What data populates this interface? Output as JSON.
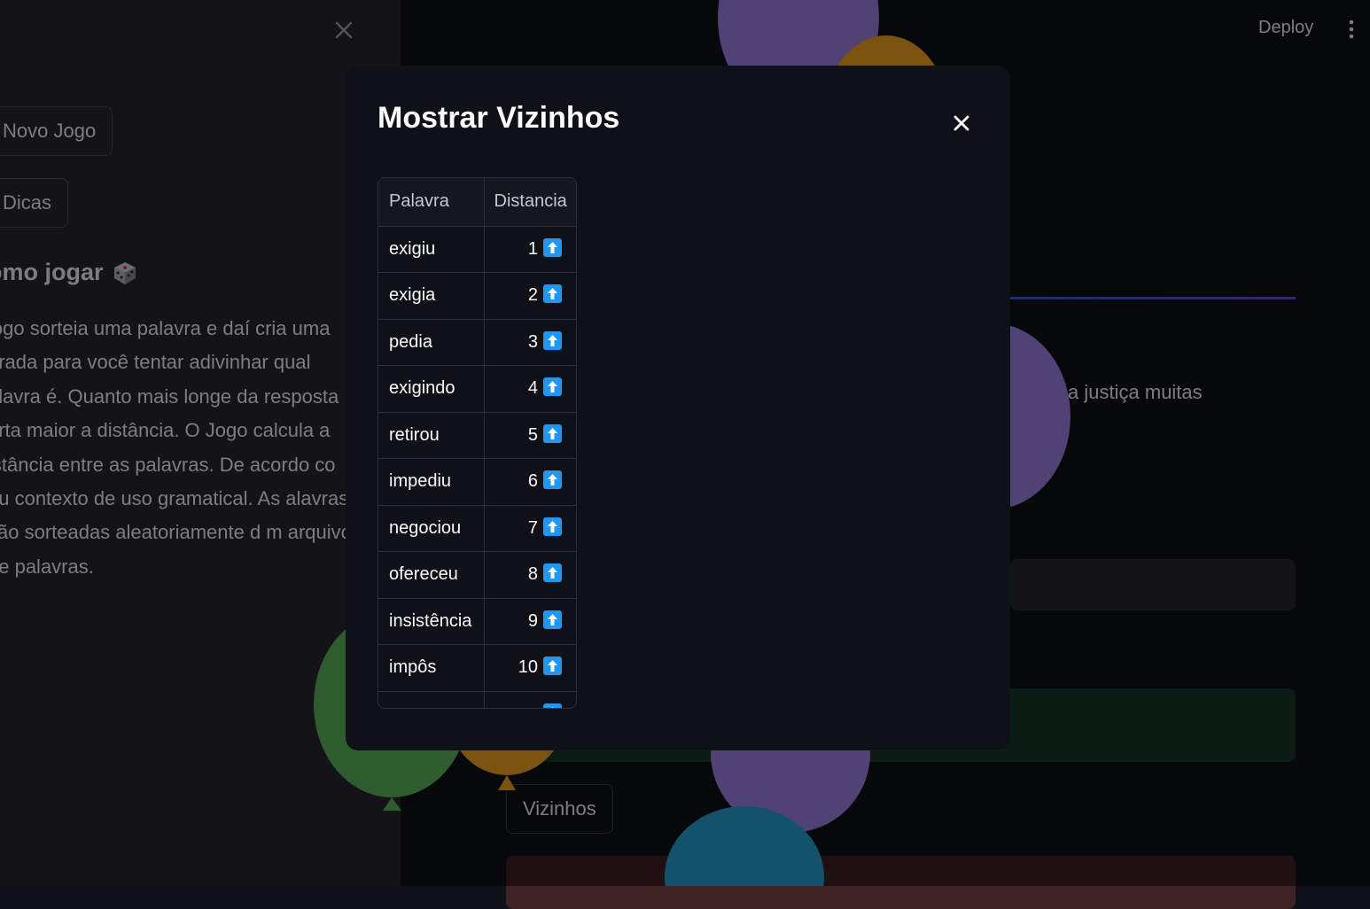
{
  "sidebar": {
    "new_game_label": "Novo Jogo",
    "tips_label": "Dicas",
    "how_to_heading": "omo jogar",
    "how_to_text": "jogo sorteia uma palavra e daí cria uma arada para você tentar adivinhar qual alavra é. Quanto mais longe da resposta erta maior a distância. O Jogo calcula a istância entre as palavras. De acordo co eu contexto de uso gramatical. As alavras são sorteadas aleatoriamente d m arquivo de palavras."
  },
  "header": {
    "deploy_label": "Deploy"
  },
  "main": {
    "riddle_fragment": "í que a justiça muitas",
    "neighbors_button": "Vizinhos"
  },
  "modal": {
    "title": "Mostrar Vizinhos",
    "columns": [
      "Palavra",
      "Distancia"
    ],
    "rows": [
      {
        "word": "exigiu",
        "distance": "1"
      },
      {
        "word": "exigia",
        "distance": "2"
      },
      {
        "word": "pedia",
        "distance": "3"
      },
      {
        "word": "exigindo",
        "distance": "4"
      },
      {
        "word": "retirou",
        "distance": "5"
      },
      {
        "word": "impediu",
        "distance": "6"
      },
      {
        "word": "negociou",
        "distance": "7"
      },
      {
        "word": "ofereceu",
        "distance": "8"
      },
      {
        "word": "insistência",
        "distance": "9"
      },
      {
        "word": "impôs",
        "distance": "10"
      },
      {
        "word": "",
        "distance": ""
      }
    ],
    "row_icon": "up-arrow-icon"
  },
  "colors": {
    "background": "#0e1117",
    "sidebar": "#262730",
    "up_icon": "#2196f3"
  }
}
